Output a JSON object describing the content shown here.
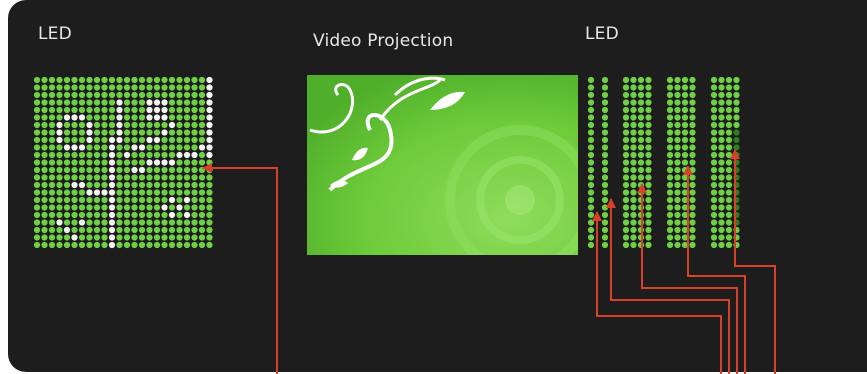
{
  "labels": {
    "led_left": "LED",
    "video_projection": "Video Projection",
    "led_right": "LED"
  },
  "colors": {
    "background": "#1c1d1c",
    "led_green": "#6fcf45",
    "arrow_red": "#d9402a",
    "projection_green": "#6ecb3a"
  },
  "icons": [
    "arrow-icon",
    "floral-swirl-graphic",
    "led-dot-matrix"
  ]
}
